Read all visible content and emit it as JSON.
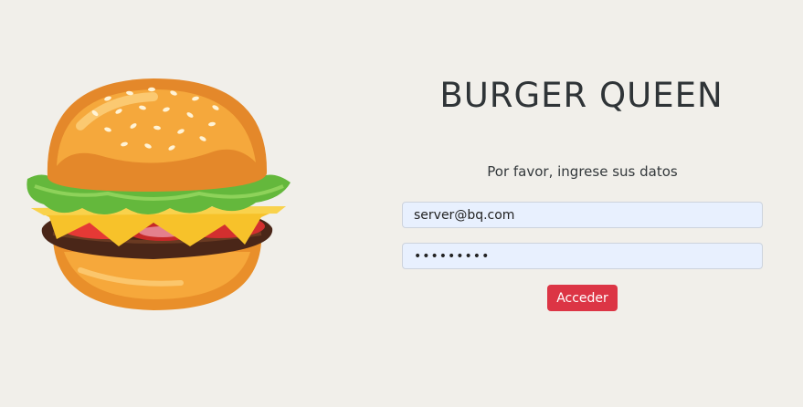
{
  "branding": {
    "title": "BURGER QUEEN",
    "illustration_icon": "burger-icon"
  },
  "login": {
    "prompt": "Por favor, ingrese sus datos",
    "email_value": "server@bq.com",
    "password_value": "•••••••••",
    "submit_label": "Acceder"
  },
  "colors": {
    "background": "#f1efea",
    "accent": "#dc3545",
    "input_fill": "#e8f0fe"
  }
}
